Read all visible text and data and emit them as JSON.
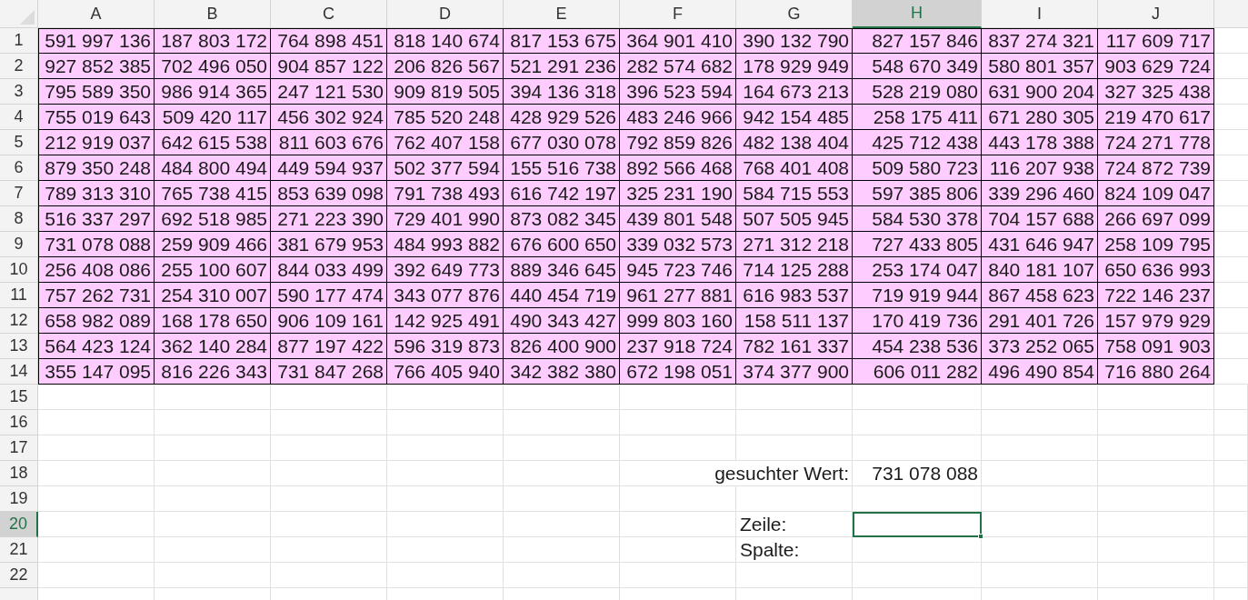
{
  "column_headers": [
    {
      "label": "A",
      "selected": false
    },
    {
      "label": "B",
      "selected": false
    },
    {
      "label": "C",
      "selected": false
    },
    {
      "label": "D",
      "selected": false
    },
    {
      "label": "E",
      "selected": false
    },
    {
      "label": "F",
      "selected": false
    },
    {
      "label": "G",
      "selected": false
    },
    {
      "label": "H",
      "selected": true
    },
    {
      "label": "I",
      "selected": false
    },
    {
      "label": "J",
      "selected": false
    }
  ],
  "row_headers": [
    {
      "label": "1",
      "selected": false
    },
    {
      "label": "2",
      "selected": false
    },
    {
      "label": "3",
      "selected": false
    },
    {
      "label": "4",
      "selected": false
    },
    {
      "label": "5",
      "selected": false
    },
    {
      "label": "6",
      "selected": false
    },
    {
      "label": "7",
      "selected": false
    },
    {
      "label": "8",
      "selected": false
    },
    {
      "label": "9",
      "selected": false
    },
    {
      "label": "10",
      "selected": false
    },
    {
      "label": "11",
      "selected": false
    },
    {
      "label": "12",
      "selected": false
    },
    {
      "label": "13",
      "selected": false
    },
    {
      "label": "14",
      "selected": false
    },
    {
      "label": "15",
      "selected": false
    },
    {
      "label": "16",
      "selected": false
    },
    {
      "label": "17",
      "selected": false
    },
    {
      "label": "18",
      "selected": false
    },
    {
      "label": "19",
      "selected": false
    },
    {
      "label": "20",
      "selected": true
    },
    {
      "label": "21",
      "selected": false
    },
    {
      "label": "22",
      "selected": false
    }
  ],
  "table": {
    "rows": [
      [
        "591 997 136",
        "187 803 172",
        "764 898 451",
        "818 140 674",
        "817 153 675",
        "364 901 410",
        "390 132 790",
        "827 157 846",
        "837 274 321",
        "117 609 717"
      ],
      [
        "927 852 385",
        "702 496 050",
        "904 857 122",
        "206 826 567",
        "521 291 236",
        "282 574 682",
        "178 929 949",
        "548 670 349",
        "580 801 357",
        "903 629 724"
      ],
      [
        "795 589 350",
        "986 914 365",
        "247 121 530",
        "909 819 505",
        "394 136 318",
        "396 523 594",
        "164 673 213",
        "528 219 080",
        "631 900 204",
        "327 325 438"
      ],
      [
        "755 019 643",
        "509 420 117",
        "456 302 924",
        "785 520 248",
        "428 929 526",
        "483 246 966",
        "942 154 485",
        "258 175 411",
        "671 280 305",
        "219 470 617"
      ],
      [
        "212 919 037",
        "642 615 538",
        "811 603 676",
        "762 407 158",
        "677 030 078",
        "792 859 826",
        "482 138 404",
        "425 712 438",
        "443 178 388",
        "724 271 778"
      ],
      [
        "879 350 248",
        "484 800 494",
        "449 594 937",
        "502 377 594",
        "155 516 738",
        "892 566 468",
        "768 401 408",
        "509 580 723",
        "116 207 938",
        "724 872 739"
      ],
      [
        "789 313 310",
        "765 738 415",
        "853 639 098",
        "791 738 493",
        "616 742 197",
        "325 231 190",
        "584 715 553",
        "597 385 806",
        "339 296 460",
        "824 109 047"
      ],
      [
        "516 337 297",
        "692 518 985",
        "271 223 390",
        "729 401 990",
        "873 082 345",
        "439 801 548",
        "507 505 945",
        "584 530 378",
        "704 157 688",
        "266 697 099"
      ],
      [
        "731 078 088",
        "259 909 466",
        "381 679 953",
        "484 993 882",
        "676 600 650",
        "339 032 573",
        "271 312 218",
        "727 433 805",
        "431 646 947",
        "258 109 795"
      ],
      [
        "256 408 086",
        "255 100 607",
        "844 033 499",
        "392 649 773",
        "889 346 645",
        "945 723 746",
        "714 125 288",
        "253 174 047",
        "840 181 107",
        "650 636 993"
      ],
      [
        "757 262 731",
        "254 310 007",
        "590 177 474",
        "343 077 876",
        "440 454 719",
        "961 277 881",
        "616 983 537",
        "719 919 944",
        "867 458 623",
        "722 146 237"
      ],
      [
        "658 982 089",
        "168 178 650",
        "906 109 161",
        "142 925 491",
        "490 343 427",
        "999 803 160",
        "158 511 137",
        "170 419 736",
        "291 401 726",
        "157 979 929"
      ],
      [
        "564 423 124",
        "362 140 284",
        "877 197 422",
        "596 319 873",
        "826 400 900",
        "237 918 724",
        "782 161 337",
        "454 238 536",
        "373 252 065",
        "758 091 903"
      ],
      [
        "355 147 095",
        "816 226 343",
        "731 847 268",
        "766 405 940",
        "342 382 380",
        "672 198 051",
        "374 377 900",
        "606 011 282",
        "496 490 854",
        "716 880 264"
      ]
    ]
  },
  "lookup": {
    "label": "gesuchter Wert:",
    "value": "731 078 088"
  },
  "result_labels": [
    "Zeile:",
    "Spalte:"
  ]
}
